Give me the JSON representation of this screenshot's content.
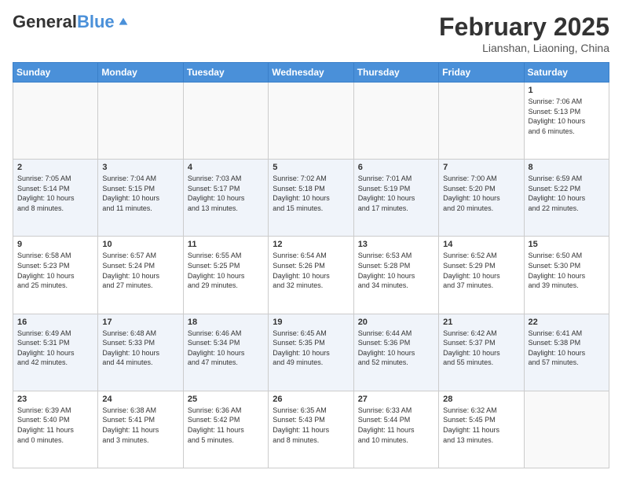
{
  "header": {
    "logo_line1": "General",
    "logo_line2": "Blue",
    "title": "February 2025",
    "location": "Lianshan, Liaoning, China"
  },
  "weekdays": [
    "Sunday",
    "Monday",
    "Tuesday",
    "Wednesday",
    "Thursday",
    "Friday",
    "Saturday"
  ],
  "weeks": [
    [
      {
        "day": "",
        "info": ""
      },
      {
        "day": "",
        "info": ""
      },
      {
        "day": "",
        "info": ""
      },
      {
        "day": "",
        "info": ""
      },
      {
        "day": "",
        "info": ""
      },
      {
        "day": "",
        "info": ""
      },
      {
        "day": "1",
        "info": "Sunrise: 7:06 AM\nSunset: 5:13 PM\nDaylight: 10 hours\nand 6 minutes."
      }
    ],
    [
      {
        "day": "2",
        "info": "Sunrise: 7:05 AM\nSunset: 5:14 PM\nDaylight: 10 hours\nand 8 minutes."
      },
      {
        "day": "3",
        "info": "Sunrise: 7:04 AM\nSunset: 5:15 PM\nDaylight: 10 hours\nand 11 minutes."
      },
      {
        "day": "4",
        "info": "Sunrise: 7:03 AM\nSunset: 5:17 PM\nDaylight: 10 hours\nand 13 minutes."
      },
      {
        "day": "5",
        "info": "Sunrise: 7:02 AM\nSunset: 5:18 PM\nDaylight: 10 hours\nand 15 minutes."
      },
      {
        "day": "6",
        "info": "Sunrise: 7:01 AM\nSunset: 5:19 PM\nDaylight: 10 hours\nand 17 minutes."
      },
      {
        "day": "7",
        "info": "Sunrise: 7:00 AM\nSunset: 5:20 PM\nDaylight: 10 hours\nand 20 minutes."
      },
      {
        "day": "8",
        "info": "Sunrise: 6:59 AM\nSunset: 5:22 PM\nDaylight: 10 hours\nand 22 minutes."
      }
    ],
    [
      {
        "day": "9",
        "info": "Sunrise: 6:58 AM\nSunset: 5:23 PM\nDaylight: 10 hours\nand 25 minutes."
      },
      {
        "day": "10",
        "info": "Sunrise: 6:57 AM\nSunset: 5:24 PM\nDaylight: 10 hours\nand 27 minutes."
      },
      {
        "day": "11",
        "info": "Sunrise: 6:55 AM\nSunset: 5:25 PM\nDaylight: 10 hours\nand 29 minutes."
      },
      {
        "day": "12",
        "info": "Sunrise: 6:54 AM\nSunset: 5:26 PM\nDaylight: 10 hours\nand 32 minutes."
      },
      {
        "day": "13",
        "info": "Sunrise: 6:53 AM\nSunset: 5:28 PM\nDaylight: 10 hours\nand 34 minutes."
      },
      {
        "day": "14",
        "info": "Sunrise: 6:52 AM\nSunset: 5:29 PM\nDaylight: 10 hours\nand 37 minutes."
      },
      {
        "day": "15",
        "info": "Sunrise: 6:50 AM\nSunset: 5:30 PM\nDaylight: 10 hours\nand 39 minutes."
      }
    ],
    [
      {
        "day": "16",
        "info": "Sunrise: 6:49 AM\nSunset: 5:31 PM\nDaylight: 10 hours\nand 42 minutes."
      },
      {
        "day": "17",
        "info": "Sunrise: 6:48 AM\nSunset: 5:33 PM\nDaylight: 10 hours\nand 44 minutes."
      },
      {
        "day": "18",
        "info": "Sunrise: 6:46 AM\nSunset: 5:34 PM\nDaylight: 10 hours\nand 47 minutes."
      },
      {
        "day": "19",
        "info": "Sunrise: 6:45 AM\nSunset: 5:35 PM\nDaylight: 10 hours\nand 49 minutes."
      },
      {
        "day": "20",
        "info": "Sunrise: 6:44 AM\nSunset: 5:36 PM\nDaylight: 10 hours\nand 52 minutes."
      },
      {
        "day": "21",
        "info": "Sunrise: 6:42 AM\nSunset: 5:37 PM\nDaylight: 10 hours\nand 55 minutes."
      },
      {
        "day": "22",
        "info": "Sunrise: 6:41 AM\nSunset: 5:38 PM\nDaylight: 10 hours\nand 57 minutes."
      }
    ],
    [
      {
        "day": "23",
        "info": "Sunrise: 6:39 AM\nSunset: 5:40 PM\nDaylight: 11 hours\nand 0 minutes."
      },
      {
        "day": "24",
        "info": "Sunrise: 6:38 AM\nSunset: 5:41 PM\nDaylight: 11 hours\nand 3 minutes."
      },
      {
        "day": "25",
        "info": "Sunrise: 6:36 AM\nSunset: 5:42 PM\nDaylight: 11 hours\nand 5 minutes."
      },
      {
        "day": "26",
        "info": "Sunrise: 6:35 AM\nSunset: 5:43 PM\nDaylight: 11 hours\nand 8 minutes."
      },
      {
        "day": "27",
        "info": "Sunrise: 6:33 AM\nSunset: 5:44 PM\nDaylight: 11 hours\nand 10 minutes."
      },
      {
        "day": "28",
        "info": "Sunrise: 6:32 AM\nSunset: 5:45 PM\nDaylight: 11 hours\nand 13 minutes."
      },
      {
        "day": "",
        "info": ""
      }
    ]
  ]
}
